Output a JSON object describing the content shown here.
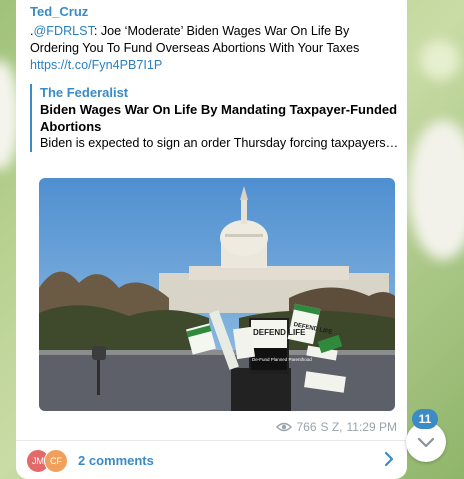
{
  "message": {
    "sender": "Ted_Cruz",
    "text_prefix": ".",
    "mention": "@FDRLST",
    "text_body": ": Joe ‘Moderate’ Biden Wages War On Life By Ordering You To Fund Overseas Abortions With Your Taxes",
    "link": "https://t.co/Fyn4PB7I1P"
  },
  "preview": {
    "site": "The Federalist",
    "title": "Biden Wages War On Life By Mandating Taxpayer-Funded Abortions",
    "description": "Biden is expected to sign an order Thursday forcing taxpayers to fund abortions in foreign countries, claiming i..."
  },
  "photo_signs": {
    "sign1": "DEFEND LIFE",
    "sign2": "DEFEND LIFE",
    "sign3": "De-Fund Planned Parenthood"
  },
  "meta": {
    "views": "766",
    "author": "S Z,",
    "time": "11:29 PM"
  },
  "comments": {
    "avatar1": "JM",
    "avatar2": "CF",
    "label": "2 comments"
  },
  "scroll": {
    "badge": "11"
  },
  "colors": {
    "accent": "#3a8bc6",
    "avatar1": "#e36a6a",
    "avatar2": "#f0a05a"
  }
}
